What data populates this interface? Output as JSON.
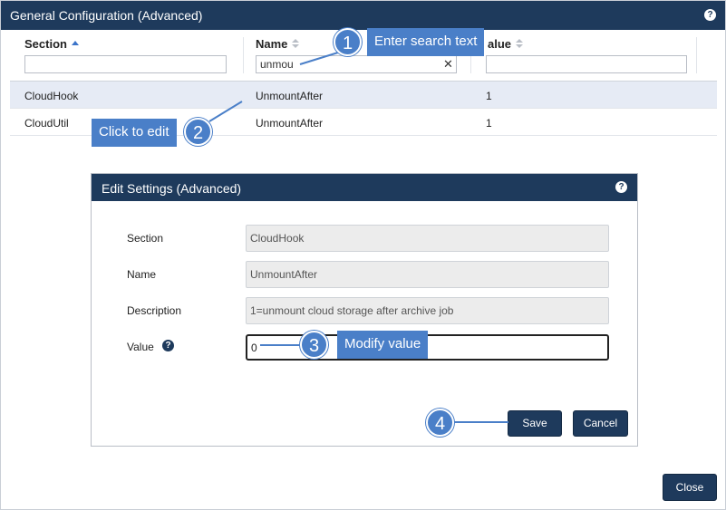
{
  "window": {
    "title": "General Configuration (Advanced)",
    "help_icon": "?"
  },
  "table": {
    "columns": [
      {
        "label": "Section",
        "sort": "ascending"
      },
      {
        "label": "Name",
        "sort": "none"
      },
      {
        "label": "alue",
        "sort": "none"
      }
    ],
    "filters": {
      "section": "",
      "name": "unmou",
      "value": ""
    },
    "clear_icon": "✕",
    "rows": [
      {
        "section": "CloudHook",
        "name": "UnmountAfter",
        "value": "1",
        "selected": true
      },
      {
        "section": "CloudUtil",
        "name": "UnmountAfter",
        "value": "1",
        "selected": false
      }
    ]
  },
  "dialog": {
    "title": "Edit Settings (Advanced)",
    "help_icon": "?",
    "fields": {
      "section_label": "Section",
      "section_value": "CloudHook",
      "name_label": "Name",
      "name_value": "UnmountAfter",
      "description_label": "Description",
      "description_value": "1=unmount cloud storage after archive job",
      "value_label": "Value",
      "value_value": "0",
      "value_info_icon": "?"
    },
    "save_label": "Save",
    "cancel_label": "Cancel"
  },
  "close_label": "Close",
  "callouts": [
    {
      "number": "1",
      "text": "Enter search text"
    },
    {
      "number": "2",
      "text": "Click to edit"
    },
    {
      "number": "3",
      "text": "Modify value"
    },
    {
      "number": "4",
      "text": ""
    }
  ],
  "colors": {
    "titlebar": "#1e3a5c",
    "callout": "#4a7fc8",
    "selected_row": "#e6ebf5",
    "sort_active": "#3b74c9"
  }
}
